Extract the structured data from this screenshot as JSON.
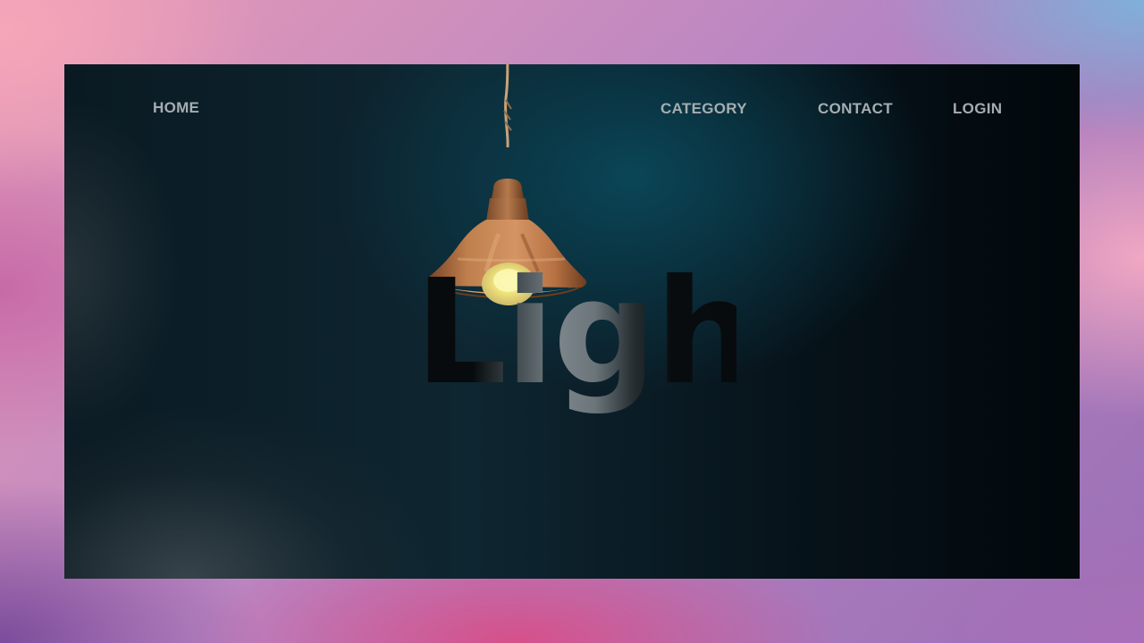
{
  "nav": {
    "home": "HOME",
    "category": "CATEGORY",
    "contact": "CONTACT",
    "login": "LOGIN"
  },
  "hero": {
    "title": "Light",
    "image": "hanging-lamp-icon"
  },
  "colors": {
    "nav_text": "#a6adb1",
    "panel_dark": "#061118",
    "panel_glow": "#0a485a",
    "lamp_copper": "#c07a4a",
    "bulb": "#f6f29a"
  }
}
